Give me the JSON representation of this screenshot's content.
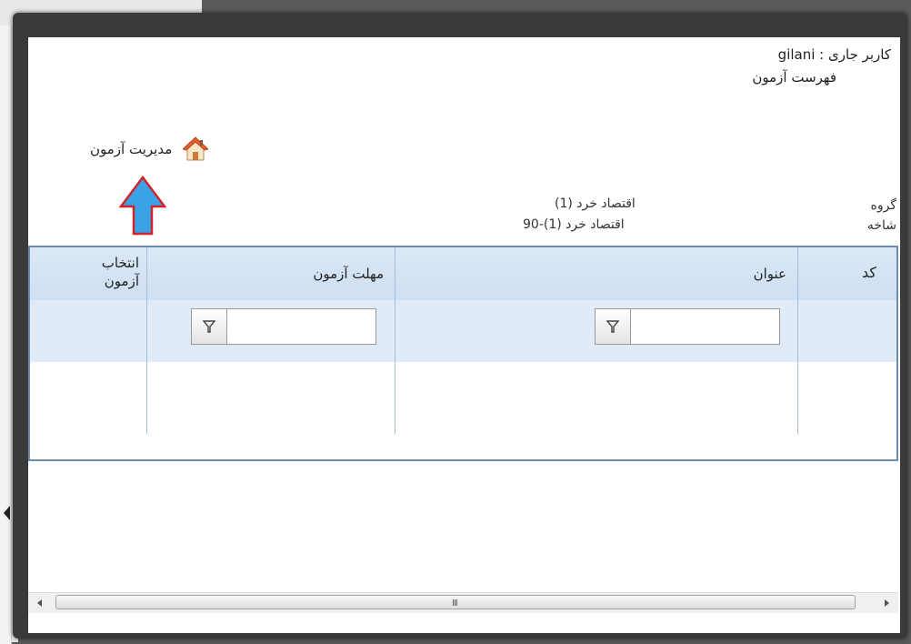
{
  "current_user_line": "کاربر جاری : gilani",
  "page_title": "فهرست آزمون",
  "management_link": "مدیریت آزمون",
  "info": {
    "group_label": "گروه",
    "group_value": "اقتصاد خرد (1)",
    "branch_label": "شاخه",
    "branch_value": "اقتصاد خرد (1)-90"
  },
  "table": {
    "headers": {
      "code": "کد",
      "title": "عنوان",
      "deadline": "مهلت آزمون",
      "select": "انتخاب آزمون"
    },
    "filters": {
      "title_value": "",
      "deadline_value": ""
    }
  },
  "scrollbar": {
    "grip": "III"
  },
  "colors": {
    "header_bg": "#dbe8f6",
    "border": "#6e8cb1",
    "arrow_fill": "#3aa3e6",
    "arrow_stroke": "#d2232a"
  },
  "icons": [
    "house-icon",
    "filter-icon",
    "up-arrow-icon"
  ]
}
